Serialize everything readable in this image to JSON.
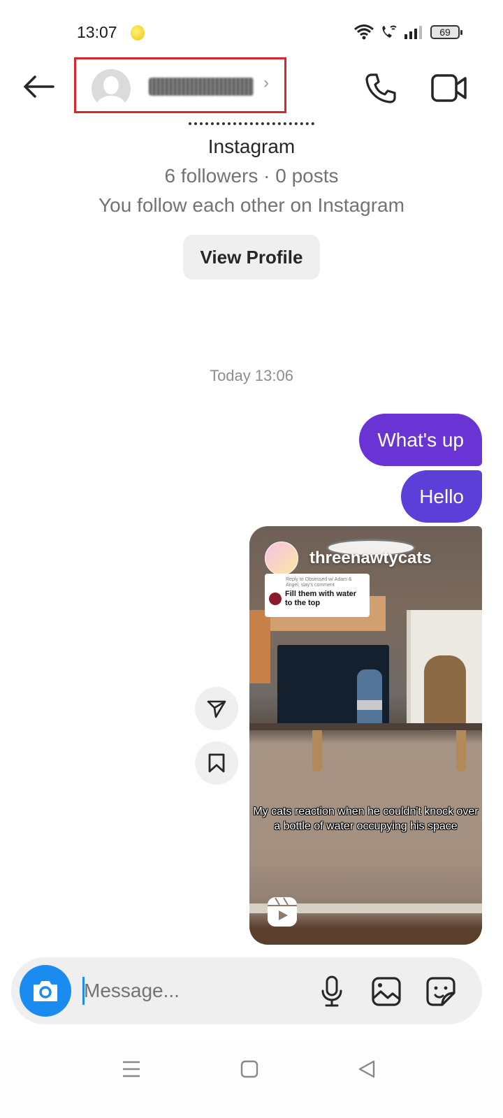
{
  "status_bar": {
    "time": "13:07",
    "battery": "69",
    "icons": [
      "notification-emoji-icon",
      "wifi-icon",
      "wifi-calling-icon",
      "signal-icon",
      "battery-icon"
    ]
  },
  "header": {
    "back_icon": "arrow-left-icon",
    "username_redacted": "",
    "chevron": "›",
    "call_icon": "phone-icon",
    "video_icon": "video-camera-icon"
  },
  "profile": {
    "platform": "Instagram",
    "stats": "6 followers · 0 posts",
    "mutual": "You follow each other on Instagram",
    "view_profile_label": "View Profile"
  },
  "conversation": {
    "timestamp": "Today 13:06",
    "messages": [
      {
        "sender": "me",
        "type": "text",
        "text": "What's up"
      },
      {
        "sender": "me",
        "type": "text",
        "text": "Hello"
      },
      {
        "sender": "me",
        "type": "reel",
        "account": "threenawtycats",
        "reply_caption": "Reply to Obsessed w/ Adam & Angel, slay's comment",
        "reply_text": "Fill them with water to the top",
        "caption": "My cats reaction when he couldn't knock over a bottle of water occupying his space"
      }
    ],
    "side_actions": [
      "share-icon",
      "bookmark-icon"
    ]
  },
  "composer": {
    "placeholder": "Message...",
    "value": "",
    "icons": [
      "camera-icon",
      "microphone-icon",
      "gallery-icon",
      "sticker-icon"
    ]
  },
  "colors": {
    "bubble_primary": "#6a33d3",
    "bubble_secondary": "#5c3ed8",
    "camera_blue": "#1a8cf0",
    "highlight_red": "#d7262c"
  }
}
